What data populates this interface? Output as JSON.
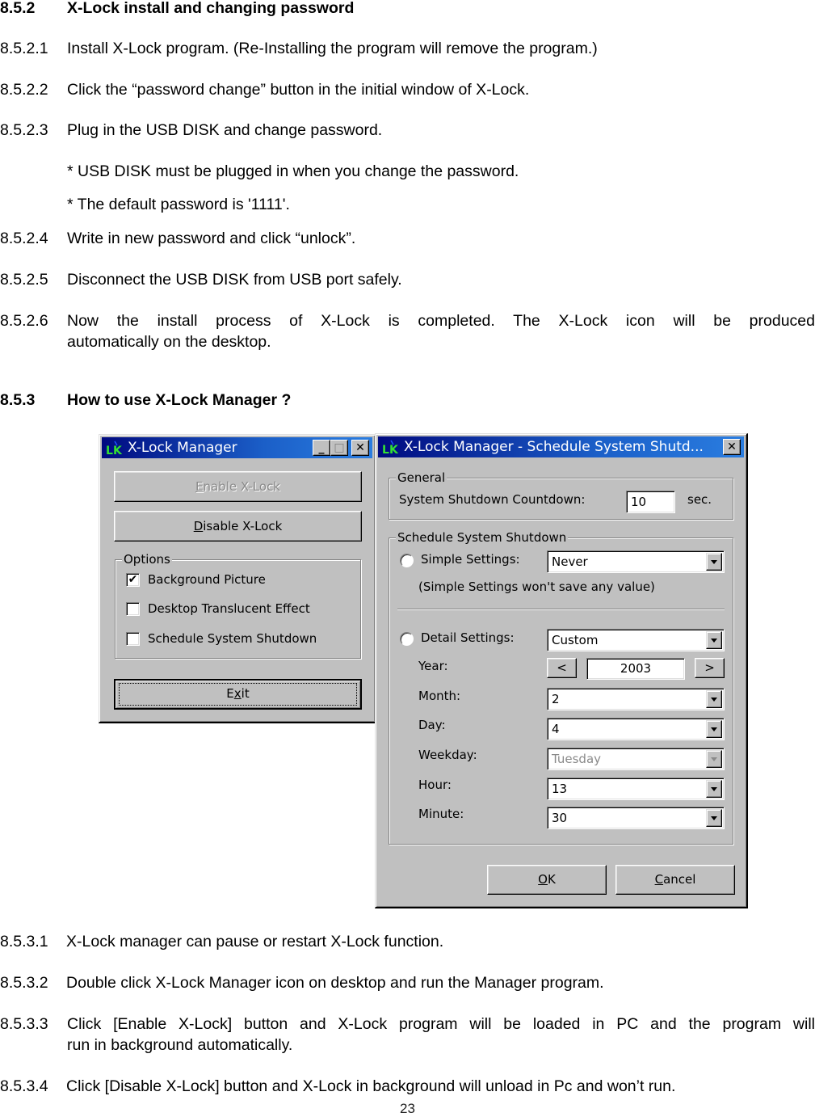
{
  "section_852": {
    "number": "8.5.2",
    "title": "X-Lock install and changing password",
    "items": [
      {
        "number": "8.5.2.1",
        "text": "Install X-Lock program. (Re-Installing the program will remove the program.)"
      },
      {
        "number": "8.5.2.2",
        "text": "Click the “password change” button in the initial window of X-Lock."
      },
      {
        "number": "8.5.2.3",
        "text": "Plug in the USB DISK and change password."
      },
      {
        "number": "",
        "text": "* USB DISK must be plugged in when you change the password."
      },
      {
        "number": "",
        "text": "* The default password is '1111'."
      },
      {
        "number": "8.5.2.4",
        "text": "Write in new password and click “unlock”."
      },
      {
        "number": "8.5.2.5",
        "text": "Disconnect the USB DISK from USB port safely."
      },
      {
        "number": "8.5.2.6",
        "text_line1": "Now the install process of X-Lock is completed. The X-Lock icon will be produced",
        "text_line2": "automatically on the desktop."
      }
    ]
  },
  "section_853": {
    "number": "8.5.3",
    "title": "How to use X-Lock Manager ?",
    "items": [
      {
        "number": "8.5.3.1",
        "text": "X-Lock manager can pause or restart X-Lock function."
      },
      {
        "number": "8.5.3.2",
        "text": "Double click X-Lock Manager icon on desktop and run the Manager program."
      },
      {
        "number": "8.5.3.3",
        "text_line1": "Click [Enable X-Lock] button and X-Lock program will be loaded in PC and the program will",
        "text_line2": "run in background automatically."
      },
      {
        "number": "8.5.3.4",
        "text": "Click [Disable X-Lock] button and X-Lock in background will unload in Pc and won’t run."
      }
    ]
  },
  "manager_window": {
    "logo_text": "LK",
    "title": "X-Lock Manager",
    "minimize_glyph": "_",
    "maximize_glyph": "□",
    "close_glyph": "✕",
    "enable_button": {
      "pre": "",
      "accel": "E",
      "post": "nable X-Lock",
      "enabled": false
    },
    "disable_button": {
      "pre": "",
      "accel": "D",
      "post": "isable X-Lock",
      "enabled": true
    },
    "options_legend": "Options",
    "options": [
      {
        "label": "Background Picture",
        "checked": true,
        "glyph": "✔"
      },
      {
        "label": "Desktop Translucent Effect",
        "checked": false,
        "glyph": ""
      },
      {
        "label": "Schedule System Shutdown",
        "checked": false,
        "glyph": ""
      }
    ],
    "exit_button": {
      "pre": "E",
      "accel": "x",
      "post": "it"
    }
  },
  "schedule_window": {
    "logo_text": "LK",
    "title": "X-Lock Manager - Schedule System Shutd...",
    "close_glyph": "✕",
    "general_legend": "General",
    "countdown_label": "System Shutdown Countdown:",
    "countdown_value": "10",
    "countdown_unit": "sec.",
    "schedule_legend": "Schedule System Shutdown",
    "simple_label": "Simple Settings:",
    "simple_value": "Never",
    "simple_note": "(Simple Settings won't save any value)",
    "detail_label": "Detail Settings:",
    "detail_value": "Custom",
    "year_label": "Year:",
    "year_prev": "<",
    "year_value": "2003",
    "year_next": ">",
    "month_label": "Month:",
    "month_value": "2",
    "day_label": "Day:",
    "day_value": "4",
    "weekday_label": "Weekday:",
    "weekday_value": "Tuesday",
    "hour_label": "Hour:",
    "hour_value": "13",
    "minute_label": "Minute:",
    "minute_value": "30",
    "ok_button": {
      "accel": "O",
      "post": "K"
    },
    "cancel_button": {
      "accel": "C",
      "post": "ancel"
    }
  },
  "page_number": "23"
}
